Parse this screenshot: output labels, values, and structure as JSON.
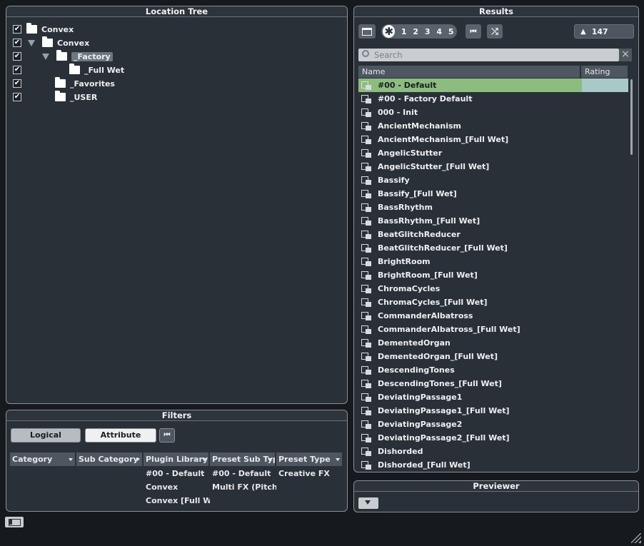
{
  "location_tree": {
    "title": "Location Tree",
    "items": [
      {
        "label": "Convex",
        "checked": true
      },
      {
        "label": "Convex",
        "checked": true
      },
      {
        "label": "_Factory",
        "checked": true
      },
      {
        "label": "_Full Wet",
        "checked": true
      },
      {
        "label": "_Favorites",
        "checked": true
      },
      {
        "label": "_USER",
        "checked": true
      }
    ],
    "check_mark": "✔"
  },
  "filters": {
    "title": "Filters",
    "logical_label": "Logical",
    "attribute_label": "Attribute",
    "columns": [
      "Category",
      "Sub Category",
      "Plugin Library N",
      "Preset Sub Type",
      "Preset Type"
    ],
    "plugin_library_values": [
      "#00 - Default",
      "Convex",
      "Convex [Full Wet"
    ],
    "preset_sub_type_values": [
      "#00 - Default",
      "Multi FX (Pitch, D"
    ],
    "preset_type_values": [
      "Creative FX"
    ]
  },
  "results": {
    "title": "Results",
    "rating_filters": [
      "1",
      "2",
      "3",
      "4",
      "5"
    ],
    "count": "147",
    "search_placeholder": "Search",
    "columns": {
      "name": "Name",
      "rating": "Rating"
    },
    "rows": [
      "#00 - Default",
      "#00 - Factory Default",
      "000 - Init",
      "AncientMechanism",
      "AncientMechanism_[Full Wet]",
      "AngelicStutter",
      "AngelicStutter_[Full Wet]",
      "Bassify",
      "Bassify_[Full Wet]",
      "BassRhythm",
      "BassRhythm_[Full Wet]",
      "BeatGlitchReducer",
      "BeatGlitchReducer_[Full Wet]",
      "BrightRoom",
      "BrightRoom_[Full Wet]",
      "ChromaCycles",
      "ChromaCycles_[Full Wet]",
      "CommanderAlbatross",
      "CommanderAlbatross_[Full Wet]",
      "DementedOrgan",
      "DementedOrgan_[Full Wet]",
      "DescendingTones",
      "DescendingTones_[Full Wet]",
      "DeviatingPassage1",
      "DeviatingPassage1_[Full Wet]",
      "DeviatingPassage2",
      "DeviatingPassage2_[Full Wet]",
      "Dishorded",
      "Dishorded_[Full Wet]"
    ],
    "selected_index": 0
  },
  "previewer": {
    "title": "Previewer"
  }
}
